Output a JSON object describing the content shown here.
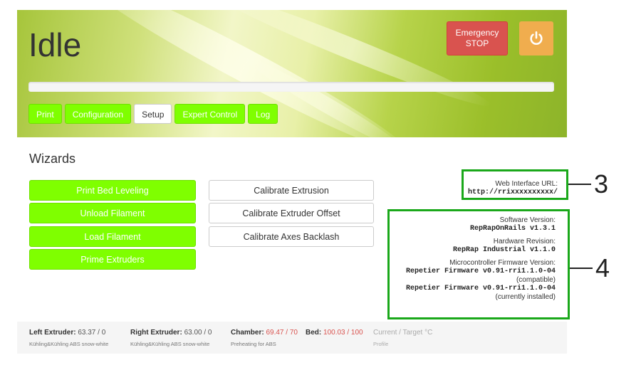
{
  "header": {
    "status_title": "Idle",
    "emergency_stop_label": "Emergency STOP",
    "power_icon": "power-icon",
    "progress_percent": 0,
    "tabs": [
      {
        "label": "Print",
        "active": false
      },
      {
        "label": "Configuration",
        "active": false
      },
      {
        "label": "Setup",
        "active": true
      },
      {
        "label": "Expert Control",
        "active": false
      },
      {
        "label": "Log",
        "active": false
      }
    ]
  },
  "wizards": {
    "title": "Wizards",
    "primary": [
      "Print Bed Leveling",
      "Unload Filament",
      "Load Filament",
      "Prime Extruders"
    ],
    "secondary": [
      "Calibrate Extrusion",
      "Calibrate Extruder Offset",
      "Calibrate Axes Backlash"
    ]
  },
  "info": {
    "web_url_label": "Web Interface URL:",
    "web_url_value": "http://rrixxxxxxxxxx/",
    "software_label": "Software Version:",
    "software_value": "RepRapOnRails v1.3.1",
    "hardware_label": "Hardware Revision:",
    "hardware_value": "RepRap Industrial v1.1.0",
    "firmware_label": "Microcontroller Firmware Version:",
    "firmware_compatible": "Repetier Firmware v0.91-rri1.1.0-04",
    "compatible_note": "(compatible)",
    "firmware_installed": "Repetier Firmware v0.91-rri1.1.0-04",
    "installed_note": "(currently installed)"
  },
  "callouts": {
    "url": "3",
    "versions": "4"
  },
  "footer": {
    "left_extruder": {
      "label": "Left Extruder:",
      "value": "63.37 / 0",
      "sub": "Kühling&Kühling ABS snow-white"
    },
    "right_extruder": {
      "label": "Right Extruder:",
      "value": "63.00 / 0",
      "sub": "Kühling&Kühling ABS snow-white"
    },
    "chamber": {
      "label": "Chamber:",
      "value": "69.47 / 70",
      "sub": "Preheating for ABS"
    },
    "bed": {
      "label": "Bed:",
      "value": "100.03 / 100"
    },
    "legend": {
      "label": "Current / Target °C",
      "sub": "Profile"
    }
  },
  "colors": {
    "accent_green": "#7fff00",
    "danger": "#d9534f",
    "warning": "#f0ad4e",
    "highlight_border": "#1aa81a"
  }
}
